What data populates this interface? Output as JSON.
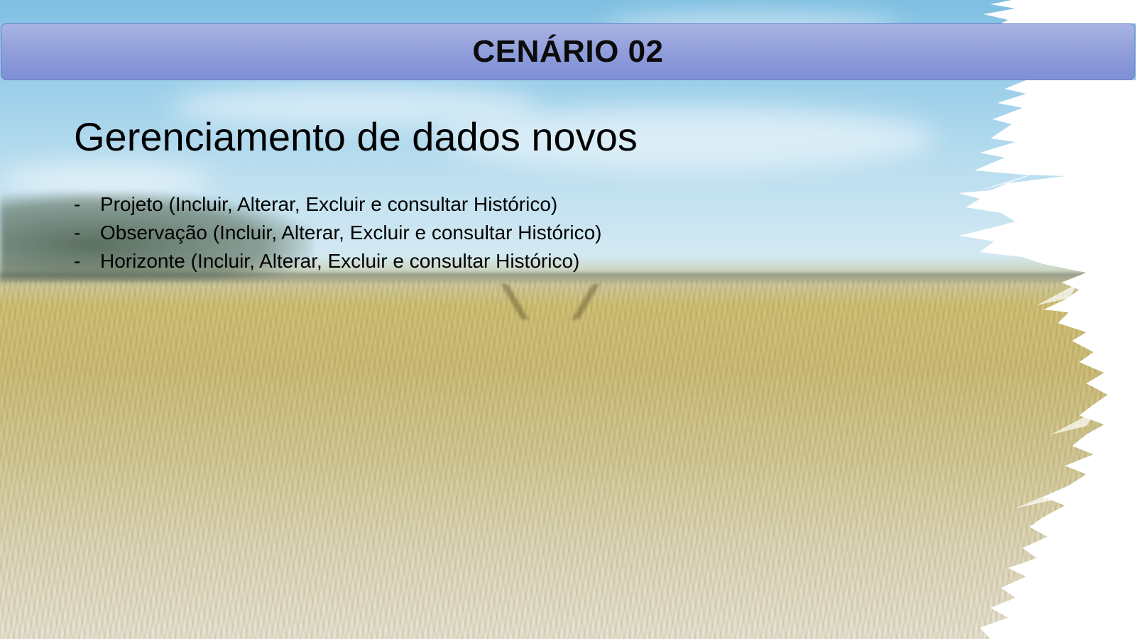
{
  "slide": {
    "title_bar": "CENÁRIO 02",
    "heading": "Gerenciamento de dados novos",
    "bullet_marker": "-",
    "bullets": [
      "Projeto (Incluir, Alterar, Excluir e consultar Histórico)",
      "Observação (Incluir, Alterar, Excluir e consultar Histórico)",
      "Horizonte (Incluir, Alterar, Excluir e consultar Histórico)"
    ]
  },
  "colors": {
    "title_bar": "#8e9cda",
    "text": "#000000",
    "sky": "#9ccfea",
    "wheat": "#c2b060"
  },
  "background": {
    "image": "sky-and-wheat-field-photo"
  }
}
